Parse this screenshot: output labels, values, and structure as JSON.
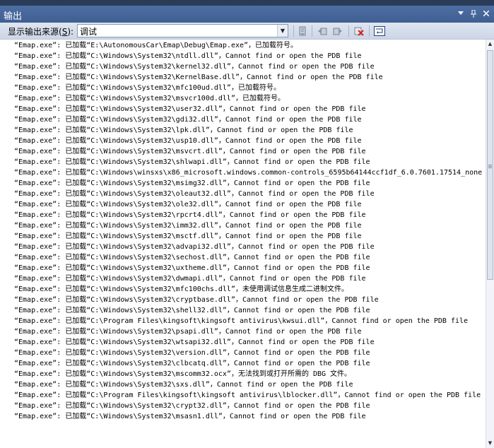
{
  "window": {
    "title": "输出"
  },
  "titlebar_icons": [
    "chevron-down-icon",
    "pin-icon",
    "close-icon"
  ],
  "toolbar": {
    "source_label_prefix": "显示输出来源(",
    "source_label_key": "S",
    "source_label_suffix": "):",
    "source_value": "调试"
  },
  "output_lines": [
    "“Emap.exe”: 已加载“E:\\AutonomousCar\\Emap\\Debug\\Emap.exe”，已加载符号。",
    "“Emap.exe”: 已加载“C:\\Windows\\System32\\ntdll.dll”，Cannot find or open the PDB file",
    "“Emap.exe”: 已加载“C:\\Windows\\System32\\kernel32.dll”，Cannot find or open the PDB file",
    "“Emap.exe”: 已加载“C:\\Windows\\System32\\KernelBase.dll”，Cannot find or open the PDB file",
    "“Emap.exe”: 已加载“C:\\Windows\\System32\\mfc100ud.dll”，已加载符号。",
    "“Emap.exe”: 已加载“C:\\Windows\\System32\\msvcr100d.dll”，已加载符号。",
    "“Emap.exe”: 已加载“C:\\Windows\\System32\\user32.dll”，Cannot find or open the PDB file",
    "“Emap.exe”: 已加载“C:\\Windows\\System32\\gdi32.dll”，Cannot find or open the PDB file",
    "“Emap.exe”: 已加载“C:\\Windows\\System32\\lpk.dll”，Cannot find or open the PDB file",
    "“Emap.exe”: 已加载“C:\\Windows\\System32\\usp10.dll”，Cannot find or open the PDB file",
    "“Emap.exe”: 已加载“C:\\Windows\\System32\\msvcrt.dll”，Cannot find or open the PDB file",
    "“Emap.exe”: 已加载“C:\\Windows\\System32\\shlwapi.dll”，Cannot find or open the PDB file",
    "“Emap.exe”: 已加载“C:\\Windows\\winsxs\\x86_microsoft.windows.common-controls_6595b64144ccf1df_6.0.7601.17514_none",
    "“Emap.exe”: 已加载“C:\\Windows\\System32\\msimg32.dll”，Cannot find or open the PDB file",
    "“Emap.exe”: 已加载“C:\\Windows\\System32\\oleaut32.dll”，Cannot find or open the PDB file",
    "“Emap.exe”: 已加载“C:\\Windows\\System32\\ole32.dll”，Cannot find or open the PDB file",
    "“Emap.exe”: 已加载“C:\\Windows\\System32\\rpcrt4.dll”，Cannot find or open the PDB file",
    "“Emap.exe”: 已加载“C:\\Windows\\System32\\imm32.dll”，Cannot find or open the PDB file",
    "“Emap.exe”: 已加载“C:\\Windows\\System32\\msctf.dll”，Cannot find or open the PDB file",
    "“Emap.exe”: 已加载“C:\\Windows\\System32\\advapi32.dll”，Cannot find or open the PDB file",
    "“Emap.exe”: 已加载“C:\\Windows\\System32\\sechost.dll”，Cannot find or open the PDB file",
    "“Emap.exe”: 已加载“C:\\Windows\\System32\\uxtheme.dll”，Cannot find or open the PDB file",
    "“Emap.exe”: 已加载“C:\\Windows\\System32\\dwmapi.dll”，Cannot find or open the PDB file",
    "“Emap.exe”: 已加载“C:\\Windows\\System32\\mfc100chs.dll”，未使用调试信息生成二进制文件。",
    "“Emap.exe”: 已加载“C:\\Windows\\System32\\cryptbase.dll”，Cannot find or open the PDB file",
    "“Emap.exe”: 已加载“C:\\Windows\\System32\\shell32.dll”，Cannot find or open the PDB file",
    "“Emap.exe”: 已加载“C:\\Program Files\\kingsoft\\kingsoft antivirus\\kwsui.dll”，Cannot find or open the PDB file",
    "“Emap.exe”: 已加载“C:\\Windows\\System32\\psapi.dll”，Cannot find or open the PDB file",
    "“Emap.exe”: 已加载“C:\\Windows\\System32\\wtsapi32.dll”，Cannot find or open the PDB file",
    "“Emap.exe”: 已加载“C:\\Windows\\System32\\version.dll”，Cannot find or open the PDB file",
    "“Emap.exe”: 已加载“C:\\Windows\\System32\\clbcatq.dll”，Cannot find or open the PDB file",
    "“Emap.exe”: 已加载“C:\\Windows\\System32\\mscomm32.ocx”，无法找到或打开所需的 DBG 文件。",
    "“Emap.exe”: 已加载“C:\\Windows\\System32\\sxs.dll”，Cannot find or open the PDB file",
    "“Emap.exe”: 已加载“C:\\Program Files\\kingsoft\\kingsoft antivirus\\lblocker.dll”，Cannot find or open the PDB file",
    "“Emap.exe”: 已加载“C:\\Windows\\System32\\crypt32.dll”，Cannot find or open the PDB file",
    "“Emap.exe”: 已加载“C:\\Windows\\System32\\msasn1.dll”，Cannot find or open the PDB file"
  ]
}
